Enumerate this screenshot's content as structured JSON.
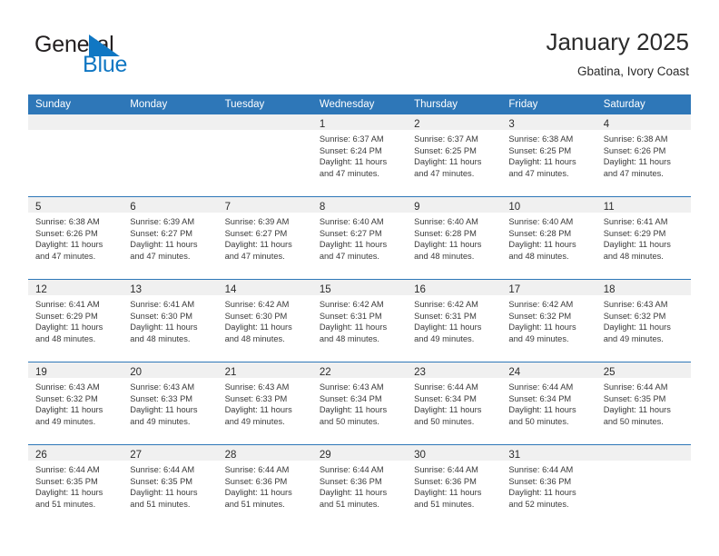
{
  "brand": {
    "name_part1": "General",
    "name_part2": "Blue",
    "accent_color": "#1077c3"
  },
  "header": {
    "title": "January 2025",
    "subtitle": "Gbatina, Ivory Coast"
  },
  "theme": {
    "header_blue": "#2e77b8",
    "day_band_gray": "#f0f0f0"
  },
  "weekdays": [
    "Sunday",
    "Monday",
    "Tuesday",
    "Wednesday",
    "Thursday",
    "Friday",
    "Saturday"
  ],
  "weeks": [
    [
      {
        "day": "",
        "empty": true,
        "sunrise": "",
        "sunset": "",
        "daylight1": "",
        "daylight2": ""
      },
      {
        "day": "",
        "empty": true,
        "sunrise": "",
        "sunset": "",
        "daylight1": "",
        "daylight2": ""
      },
      {
        "day": "",
        "empty": true,
        "sunrise": "",
        "sunset": "",
        "daylight1": "",
        "daylight2": ""
      },
      {
        "day": "1",
        "empty": false,
        "sunrise": "Sunrise: 6:37 AM",
        "sunset": "Sunset: 6:24 PM",
        "daylight1": "Daylight: 11 hours",
        "daylight2": "and 47 minutes."
      },
      {
        "day": "2",
        "empty": false,
        "sunrise": "Sunrise: 6:37 AM",
        "sunset": "Sunset: 6:25 PM",
        "daylight1": "Daylight: 11 hours",
        "daylight2": "and 47 minutes."
      },
      {
        "day": "3",
        "empty": false,
        "sunrise": "Sunrise: 6:38 AM",
        "sunset": "Sunset: 6:25 PM",
        "daylight1": "Daylight: 11 hours",
        "daylight2": "and 47 minutes."
      },
      {
        "day": "4",
        "empty": false,
        "sunrise": "Sunrise: 6:38 AM",
        "sunset": "Sunset: 6:26 PM",
        "daylight1": "Daylight: 11 hours",
        "daylight2": "and 47 minutes."
      }
    ],
    [
      {
        "day": "5",
        "empty": false,
        "sunrise": "Sunrise: 6:38 AM",
        "sunset": "Sunset: 6:26 PM",
        "daylight1": "Daylight: 11 hours",
        "daylight2": "and 47 minutes."
      },
      {
        "day": "6",
        "empty": false,
        "sunrise": "Sunrise: 6:39 AM",
        "sunset": "Sunset: 6:27 PM",
        "daylight1": "Daylight: 11 hours",
        "daylight2": "and 47 minutes."
      },
      {
        "day": "7",
        "empty": false,
        "sunrise": "Sunrise: 6:39 AM",
        "sunset": "Sunset: 6:27 PM",
        "daylight1": "Daylight: 11 hours",
        "daylight2": "and 47 minutes."
      },
      {
        "day": "8",
        "empty": false,
        "sunrise": "Sunrise: 6:40 AM",
        "sunset": "Sunset: 6:27 PM",
        "daylight1": "Daylight: 11 hours",
        "daylight2": "and 47 minutes."
      },
      {
        "day": "9",
        "empty": false,
        "sunrise": "Sunrise: 6:40 AM",
        "sunset": "Sunset: 6:28 PM",
        "daylight1": "Daylight: 11 hours",
        "daylight2": "and 48 minutes."
      },
      {
        "day": "10",
        "empty": false,
        "sunrise": "Sunrise: 6:40 AM",
        "sunset": "Sunset: 6:28 PM",
        "daylight1": "Daylight: 11 hours",
        "daylight2": "and 48 minutes."
      },
      {
        "day": "11",
        "empty": false,
        "sunrise": "Sunrise: 6:41 AM",
        "sunset": "Sunset: 6:29 PM",
        "daylight1": "Daylight: 11 hours",
        "daylight2": "and 48 minutes."
      }
    ],
    [
      {
        "day": "12",
        "empty": false,
        "sunrise": "Sunrise: 6:41 AM",
        "sunset": "Sunset: 6:29 PM",
        "daylight1": "Daylight: 11 hours",
        "daylight2": "and 48 minutes."
      },
      {
        "day": "13",
        "empty": false,
        "sunrise": "Sunrise: 6:41 AM",
        "sunset": "Sunset: 6:30 PM",
        "daylight1": "Daylight: 11 hours",
        "daylight2": "and 48 minutes."
      },
      {
        "day": "14",
        "empty": false,
        "sunrise": "Sunrise: 6:42 AM",
        "sunset": "Sunset: 6:30 PM",
        "daylight1": "Daylight: 11 hours",
        "daylight2": "and 48 minutes."
      },
      {
        "day": "15",
        "empty": false,
        "sunrise": "Sunrise: 6:42 AM",
        "sunset": "Sunset: 6:31 PM",
        "daylight1": "Daylight: 11 hours",
        "daylight2": "and 48 minutes."
      },
      {
        "day": "16",
        "empty": false,
        "sunrise": "Sunrise: 6:42 AM",
        "sunset": "Sunset: 6:31 PM",
        "daylight1": "Daylight: 11 hours",
        "daylight2": "and 49 minutes."
      },
      {
        "day": "17",
        "empty": false,
        "sunrise": "Sunrise: 6:42 AM",
        "sunset": "Sunset: 6:32 PM",
        "daylight1": "Daylight: 11 hours",
        "daylight2": "and 49 minutes."
      },
      {
        "day": "18",
        "empty": false,
        "sunrise": "Sunrise: 6:43 AM",
        "sunset": "Sunset: 6:32 PM",
        "daylight1": "Daylight: 11 hours",
        "daylight2": "and 49 minutes."
      }
    ],
    [
      {
        "day": "19",
        "empty": false,
        "sunrise": "Sunrise: 6:43 AM",
        "sunset": "Sunset: 6:32 PM",
        "daylight1": "Daylight: 11 hours",
        "daylight2": "and 49 minutes."
      },
      {
        "day": "20",
        "empty": false,
        "sunrise": "Sunrise: 6:43 AM",
        "sunset": "Sunset: 6:33 PM",
        "daylight1": "Daylight: 11 hours",
        "daylight2": "and 49 minutes."
      },
      {
        "day": "21",
        "empty": false,
        "sunrise": "Sunrise: 6:43 AM",
        "sunset": "Sunset: 6:33 PM",
        "daylight1": "Daylight: 11 hours",
        "daylight2": "and 49 minutes."
      },
      {
        "day": "22",
        "empty": false,
        "sunrise": "Sunrise: 6:43 AM",
        "sunset": "Sunset: 6:34 PM",
        "daylight1": "Daylight: 11 hours",
        "daylight2": "and 50 minutes."
      },
      {
        "day": "23",
        "empty": false,
        "sunrise": "Sunrise: 6:44 AM",
        "sunset": "Sunset: 6:34 PM",
        "daylight1": "Daylight: 11 hours",
        "daylight2": "and 50 minutes."
      },
      {
        "day": "24",
        "empty": false,
        "sunrise": "Sunrise: 6:44 AM",
        "sunset": "Sunset: 6:34 PM",
        "daylight1": "Daylight: 11 hours",
        "daylight2": "and 50 minutes."
      },
      {
        "day": "25",
        "empty": false,
        "sunrise": "Sunrise: 6:44 AM",
        "sunset": "Sunset: 6:35 PM",
        "daylight1": "Daylight: 11 hours",
        "daylight2": "and 50 minutes."
      }
    ],
    [
      {
        "day": "26",
        "empty": false,
        "sunrise": "Sunrise: 6:44 AM",
        "sunset": "Sunset: 6:35 PM",
        "daylight1": "Daylight: 11 hours",
        "daylight2": "and 51 minutes."
      },
      {
        "day": "27",
        "empty": false,
        "sunrise": "Sunrise: 6:44 AM",
        "sunset": "Sunset: 6:35 PM",
        "daylight1": "Daylight: 11 hours",
        "daylight2": "and 51 minutes."
      },
      {
        "day": "28",
        "empty": false,
        "sunrise": "Sunrise: 6:44 AM",
        "sunset": "Sunset: 6:36 PM",
        "daylight1": "Daylight: 11 hours",
        "daylight2": "and 51 minutes."
      },
      {
        "day": "29",
        "empty": false,
        "sunrise": "Sunrise: 6:44 AM",
        "sunset": "Sunset: 6:36 PM",
        "daylight1": "Daylight: 11 hours",
        "daylight2": "and 51 minutes."
      },
      {
        "day": "30",
        "empty": false,
        "sunrise": "Sunrise: 6:44 AM",
        "sunset": "Sunset: 6:36 PM",
        "daylight1": "Daylight: 11 hours",
        "daylight2": "and 51 minutes."
      },
      {
        "day": "31",
        "empty": false,
        "sunrise": "Sunrise: 6:44 AM",
        "sunset": "Sunset: 6:36 PM",
        "daylight1": "Daylight: 11 hours",
        "daylight2": "and 52 minutes."
      },
      {
        "day": "",
        "empty": true,
        "sunrise": "",
        "sunset": "",
        "daylight1": "",
        "daylight2": ""
      }
    ]
  ]
}
